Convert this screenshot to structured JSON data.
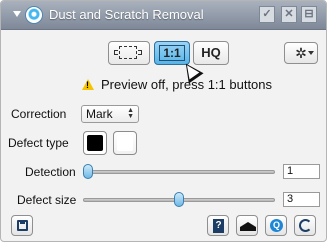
{
  "window": {
    "title": "Dust and Scratch Removal",
    "check_label": "✓",
    "close_label": "✕",
    "menu_label": "⊟"
  },
  "preview": {
    "frame_button": {
      "icon": "frame-icon"
    },
    "one_to_one_label": "1:1",
    "hq_label": "HQ",
    "active": "1:1",
    "gear_label": "✲"
  },
  "status": {
    "icon": "warning-icon",
    "message": "Preview off, press 1:1 buttons"
  },
  "correction": {
    "label": "Correction",
    "value": "Mark"
  },
  "defect_type": {
    "label": "Defect type",
    "options": [
      "black",
      "white"
    ],
    "selected": "black"
  },
  "detection": {
    "label": "Detection",
    "value": "1",
    "min": 1,
    "max": 10,
    "level": 0.0
  },
  "defect_size": {
    "label": "Defect size",
    "value": "3",
    "min": 1,
    "max": 5,
    "level": 0.5
  },
  "toolbar": {
    "save_icon": "save-icon",
    "help_icon": "help-book-icon",
    "education_icon": "graduation-cap-icon",
    "quick_help_icon": "quick-help-icon",
    "reset_icon": "reset-icon"
  },
  "colors": {
    "titlebar": "#8d96a4",
    "accent": "#56b4e8",
    "warning": "#f5c400"
  }
}
